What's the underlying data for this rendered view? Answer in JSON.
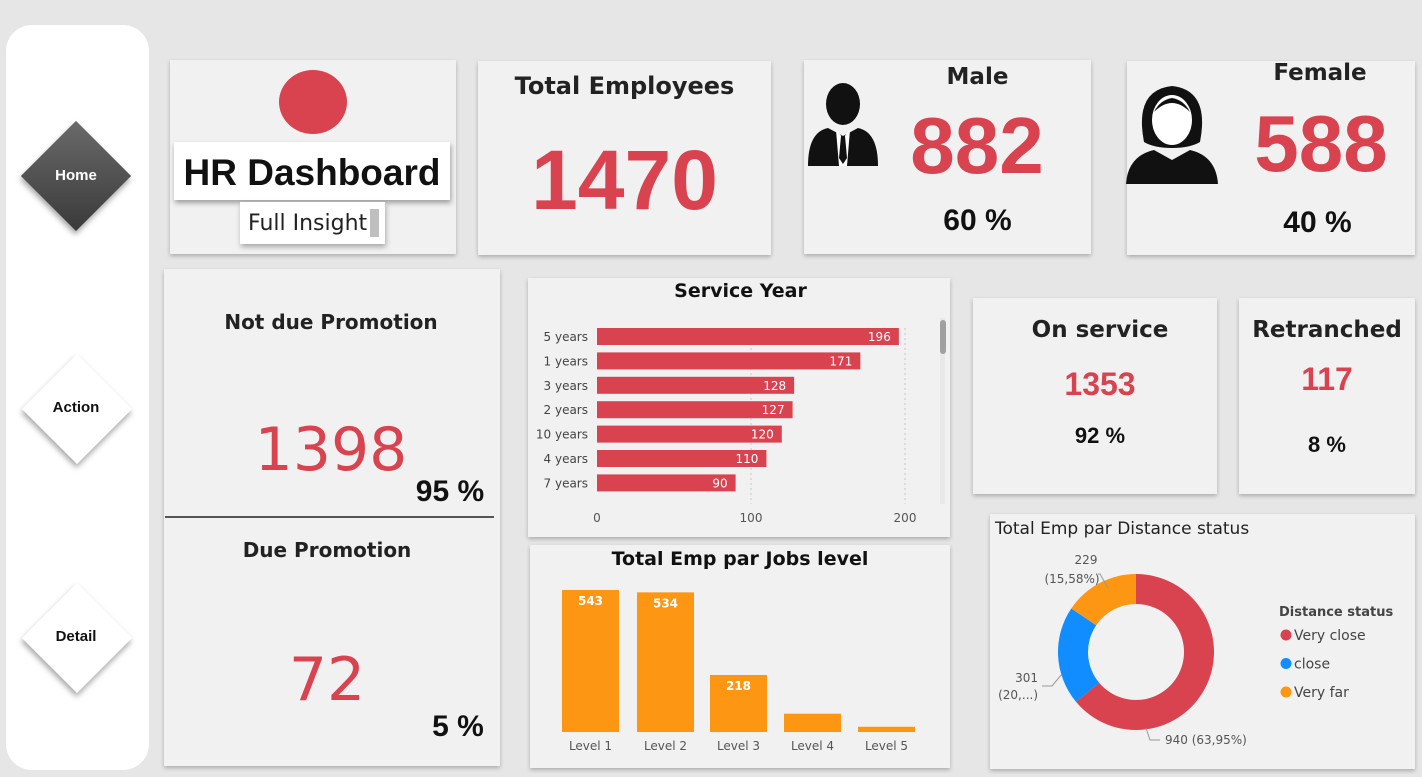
{
  "sidebar": {
    "items": [
      {
        "label": "Home",
        "active": true
      },
      {
        "label": "Action",
        "active": false
      },
      {
        "label": "Detail",
        "active": false
      }
    ]
  },
  "header": {
    "title": "HR Dashboard",
    "subtitle": "Full Insight"
  },
  "kpis": {
    "total_employees": {
      "label": "Total Employees",
      "value": "1470"
    },
    "male": {
      "label": "Male",
      "value": "882",
      "pct": "60 %",
      "icon": "male-person-icon"
    },
    "female": {
      "label": "Female",
      "value": "588",
      "pct": "40 %",
      "icon": "female-person-icon"
    },
    "not_due_promotion": {
      "label": "Not due Promotion",
      "value": "1398",
      "pct": "95 %"
    },
    "due_promotion": {
      "label": "Due Promotion",
      "value": "72",
      "pct": "5 %"
    },
    "on_service": {
      "label": "On service",
      "value": "1353",
      "pct": "92 %"
    },
    "retranched": {
      "label": "Retranched",
      "value": "117",
      "pct": "8 %"
    }
  },
  "colors": {
    "accent_red": "#d9434f",
    "orange": "#fd9613",
    "blue": "#118dff"
  },
  "chart_data": [
    {
      "type": "bar",
      "orientation": "horizontal",
      "title": "Service Year",
      "categories": [
        "5 years",
        "1 years",
        "3 years",
        "2 years",
        "10 years",
        "4 years",
        "7 years"
      ],
      "values": [
        196,
        171,
        128,
        127,
        120,
        110,
        90
      ],
      "xlim": [
        0,
        200
      ],
      "x_ticks": [
        "0",
        "100",
        "200"
      ],
      "color": "#d9434f"
    },
    {
      "type": "bar",
      "title": "Total Emp par Jobs level",
      "categories": [
        "Level 1",
        "Level 2",
        "Level 3",
        "Level 4",
        "Level 5"
      ],
      "values": [
        543,
        534,
        218,
        null,
        null
      ],
      "value_labels": [
        "543",
        "534",
        "218",
        "",
        ""
      ],
      "estimated_values": [
        543,
        534,
        218,
        70,
        20
      ],
      "color": "#fd9613"
    },
    {
      "type": "pie",
      "subtype": "donut",
      "title": "Total Emp par Distance status",
      "legend_title": "Distance status",
      "legend_position": "right",
      "slices": [
        {
          "label": "Very close",
          "value": 940,
          "display": "940 (63,95%)",
          "color": "#d9434f"
        },
        {
          "label": "close",
          "value": 301,
          "display": "301 (20,...)",
          "color": "#118dff"
        },
        {
          "label": "Very far",
          "value": 229,
          "display": "229 (15,58%)",
          "color": "#fd9613"
        }
      ]
    }
  ]
}
